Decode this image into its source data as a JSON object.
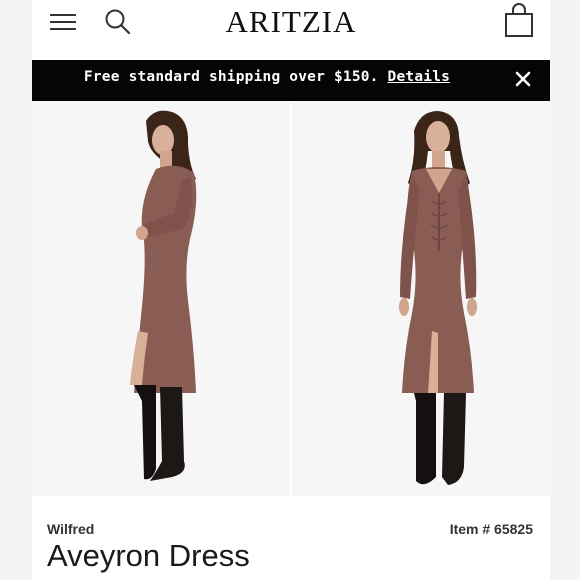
{
  "header": {
    "logo": "ARITZIA",
    "icons": {
      "menu": "hamburger-menu-icon",
      "search": "search-icon",
      "bag": "shopping-bag-icon"
    }
  },
  "promo": {
    "text": "Free standard shipping over $150.",
    "link": "Details",
    "close_icon": "close-icon"
  },
  "product": {
    "brand": "Wilfred",
    "item_number": "Item # 65825",
    "name": "Aveyron Dress",
    "dress_color": "#8a5d54"
  },
  "colors": {
    "promo_bg": "#050505",
    "page_bg": "#ffffff",
    "photo_bg": "#f6f6f6"
  }
}
